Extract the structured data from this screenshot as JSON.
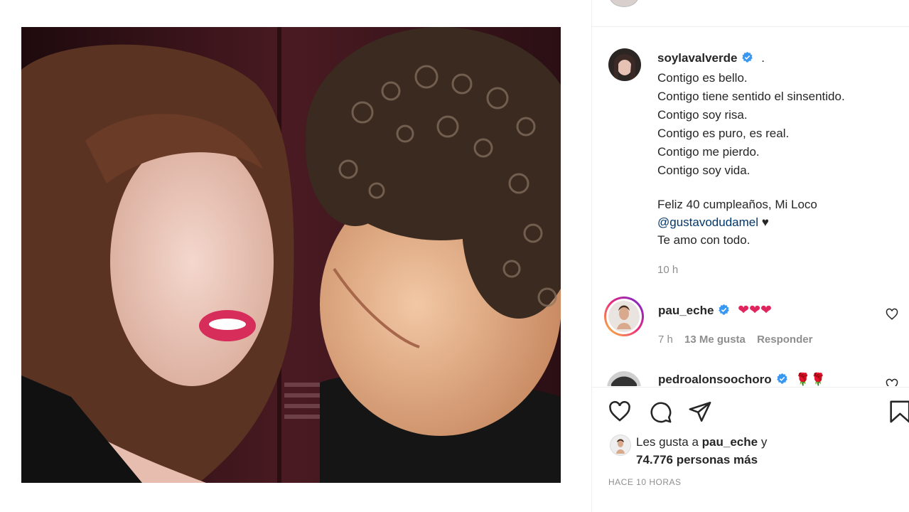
{
  "post": {
    "username": "soylavalverde",
    "caption_suffix": ".",
    "caption_lines": [
      "Contigo es bello.",
      "Contigo tiene sentido el sinsentido.",
      "Contigo soy risa.",
      "Contigo es puro, es real.",
      "Contigo me pierdo.",
      "Contigo soy vida."
    ],
    "birthday_line": "Feliz 40 cumpleaños, Mi Loco",
    "mention": "@gustavodudamel",
    "mention_emoji": "♥",
    "closing_line": "Te amo con todo.",
    "time": "10 h"
  },
  "comments": [
    {
      "username": "pau_eche",
      "text": "❤❤❤",
      "time": "7 h",
      "likes": "13 Me gusta",
      "reply": "Responder"
    },
    {
      "username": "pedroalonsoochoro",
      "text": "🌹🌹"
    }
  ],
  "likes": {
    "prefix": "Les gusta a",
    "user": "pau_eche",
    "conj": "y",
    "others": "74.776 personas más"
  },
  "timestamp": "HACE 10 HORAS",
  "colors": {
    "verified": "#3897f0",
    "heart": "#e0245e",
    "muted": "#8e8e8e"
  },
  "icons": [
    "verified-icon",
    "heart-icon",
    "comment-icon",
    "share-icon",
    "bookmark-icon"
  ]
}
